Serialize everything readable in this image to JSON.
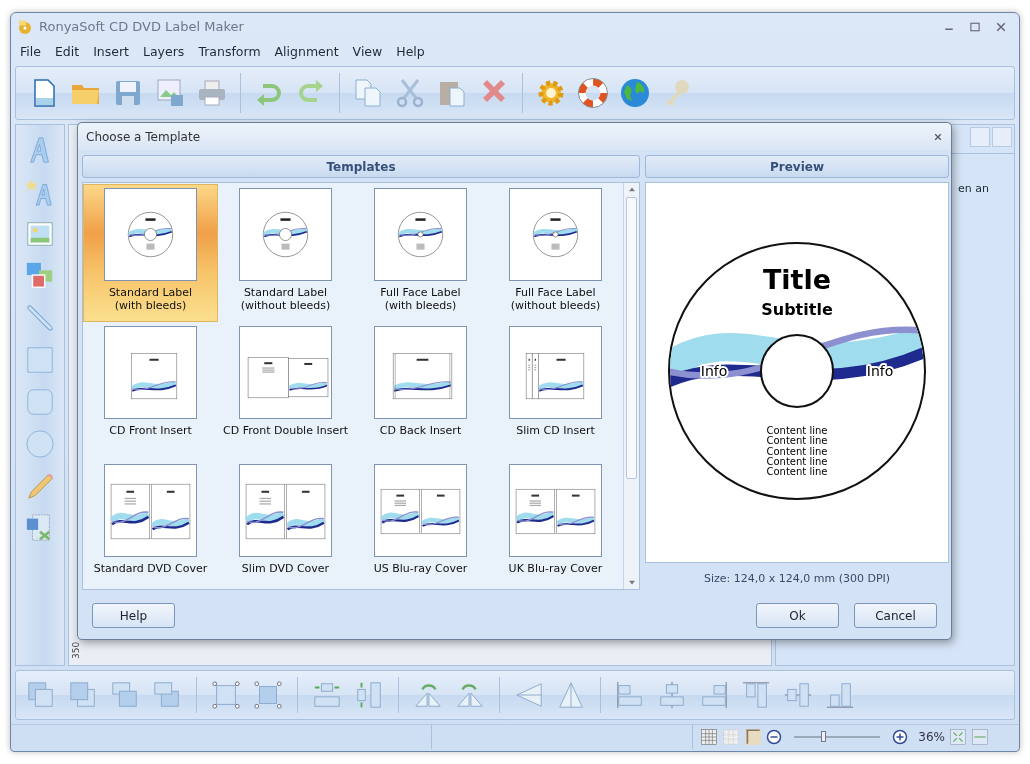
{
  "window": {
    "title": "RonyaSoft CD DVD Label Maker"
  },
  "menu": [
    "File",
    "Edit",
    "Insert",
    "Layers",
    "Transform",
    "Alignment",
    "View",
    "Help"
  ],
  "right_panel": {
    "text": "en an"
  },
  "ruler": {
    "label": "350"
  },
  "dialog": {
    "title": "Choose a Template",
    "templates_header": "Templates",
    "preview_header": "Preview",
    "templates": [
      {
        "label": "Standard Label\n(with bleeds)",
        "kind": "disc",
        "selected": true
      },
      {
        "label": "Standard Label\n(without bleeds)",
        "kind": "disc",
        "selected": false
      },
      {
        "label": "Full Face Label\n(with bleeds)",
        "kind": "fullface",
        "selected": false
      },
      {
        "label": "Full Face Label\n(without bleeds)",
        "kind": "fullface",
        "selected": false
      },
      {
        "label": "CD Front Insert",
        "kind": "front",
        "selected": false
      },
      {
        "label": "CD Front Double Insert",
        "kind": "double",
        "selected": false
      },
      {
        "label": "CD Back Insert",
        "kind": "back",
        "selected": false
      },
      {
        "label": "Slim CD Insert",
        "kind": "slim",
        "selected": false
      },
      {
        "label": "Standard DVD Cover",
        "kind": "dvd",
        "selected": false
      },
      {
        "label": "Slim DVD Cover",
        "kind": "dvd",
        "selected": false
      },
      {
        "label": "US Blu-ray Cover",
        "kind": "bluray",
        "selected": false
      },
      {
        "label": "UK Blu-ray Cover",
        "kind": "bluray",
        "selected": false
      }
    ],
    "preview": {
      "title": "Title",
      "subtitle": "Subtitle",
      "info": [
        "Info",
        "Info"
      ],
      "content_lines": [
        "Content line",
        "Content line",
        "Content line",
        "Content line",
        "Content line"
      ]
    },
    "size": "Size: 124,0 x 124,0 mm (300 DPI)",
    "buttons": {
      "help": "Help",
      "ok": "Ok",
      "cancel": "Cancel"
    }
  },
  "status_bar": {
    "zoom": "36%",
    "zoom_slider": {
      "level": 0.33
    }
  }
}
